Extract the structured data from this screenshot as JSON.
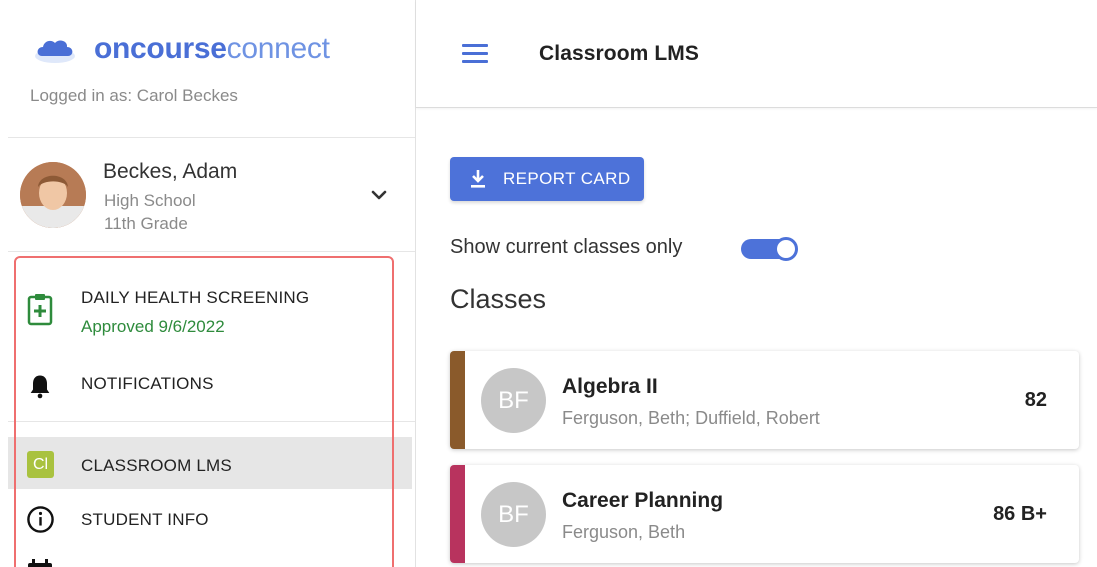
{
  "app": {
    "logo_bold": "oncourse",
    "logo_light": "connect",
    "logged_in": "Logged in as: Carol Beckes"
  },
  "student": {
    "name": "Beckes, Adam",
    "school": "High School",
    "grade": "11th Grade"
  },
  "nav": {
    "health": {
      "label": "DAILY HEALTH SCREENING",
      "status": "Approved 9/6/2022",
      "status_color": "#2e8b3c",
      "icon": "clipboard-health-icon"
    },
    "notifications": {
      "label": "NOTIFICATIONS",
      "icon": "bell-icon"
    },
    "classroom": {
      "label": "CLASSROOM LMS",
      "badge": "Cl",
      "badge_color": "#a9c23f",
      "icon": "classroom-lms-icon"
    },
    "student_info": {
      "label": "STUDENT INFO",
      "icon": "info-icon"
    },
    "calendar": {
      "icon": "calendar-icon"
    }
  },
  "header": {
    "title": "Classroom LMS"
  },
  "main": {
    "report_card_label": "REPORT CARD",
    "toggle_label": "Show current classes only",
    "toggle_on": true,
    "classes_heading": "Classes",
    "classes": [
      {
        "initials": "BF",
        "name": "Algebra II",
        "teacher": "Ferguson, Beth; Duffield, Robert",
        "grade": "82",
        "color": "#8a5a2b"
      },
      {
        "initials": "BF",
        "name": "Career Planning",
        "teacher": "Ferguson, Beth",
        "grade": "86 B+",
        "color": "#b8335e"
      }
    ]
  },
  "colors": {
    "accent": "#4d72d9",
    "highlight_border": "#ef6f6f"
  }
}
